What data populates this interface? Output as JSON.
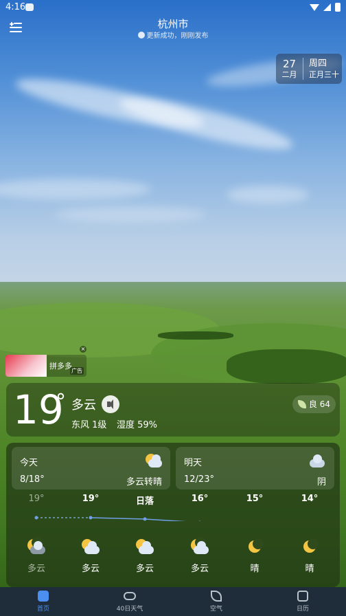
{
  "status": {
    "time": "4:16"
  },
  "header": {
    "city": "杭州市",
    "update_text": "更新成功，刚刚发布"
  },
  "date_card": {
    "day": "27",
    "month": "二月",
    "weekday": "周四",
    "lunar": "正月三十"
  },
  "ad": {
    "name": "拼多多",
    "tag": "广告"
  },
  "current": {
    "temp": "19",
    "deg": "°",
    "condition": "多云",
    "wind": "东风 1级",
    "humidity": "湿度 59%",
    "aqi": "良 64"
  },
  "today": {
    "label": "今天",
    "range": "8/18°",
    "condition": "多云转晴"
  },
  "tomorrow": {
    "label": "明天",
    "range": "12/23°",
    "condition": "阴"
  },
  "hourly": [
    {
      "temp": "19°",
      "cond": "多云",
      "icon": "partly-cloudy-night-icon",
      "past": true
    },
    {
      "temp": "19°",
      "cond": "多云",
      "icon": "partly-cloudy-icon",
      "past": false
    },
    {
      "temp": "日落",
      "cond": "多云",
      "icon": "partly-cloudy-icon",
      "past": false
    },
    {
      "temp": "16°",
      "cond": "多云",
      "icon": "partly-cloudy-night-icon",
      "past": false
    },
    {
      "temp": "15°",
      "cond": "晴",
      "icon": "moon-icon",
      "past": false
    },
    {
      "temp": "14°",
      "cond": "晴",
      "icon": "moon-icon",
      "past": false
    }
  ],
  "nav": [
    {
      "label": "首页",
      "icon": "home-icon",
      "active": true
    },
    {
      "label": "40日天气",
      "icon": "cloud-icon",
      "active": false
    },
    {
      "label": "空气",
      "icon": "leaf-icon",
      "active": false
    },
    {
      "label": "日历",
      "icon": "calendar-icon",
      "active": false
    }
  ],
  "colors": {
    "accent": "#4b8ff0",
    "nav_bg": "#1f2d3b",
    "sun": "#f6c443"
  }
}
